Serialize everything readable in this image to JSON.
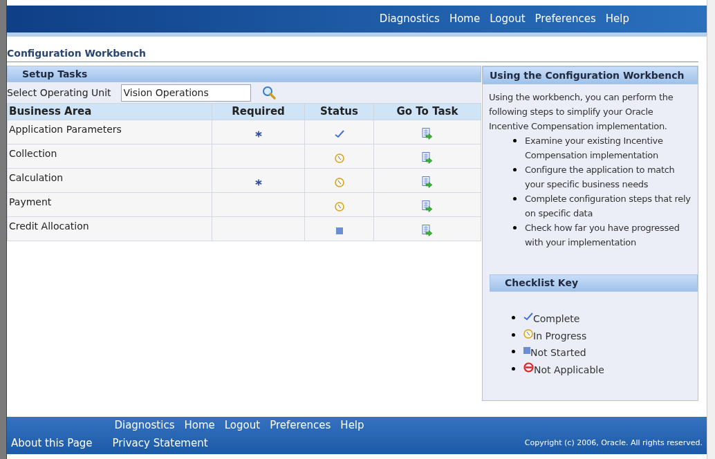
{
  "header_links": [
    "Diagnostics",
    "Home",
    "Logout",
    "Preferences",
    "Help"
  ],
  "page_title": "Configuration Workbench",
  "setup_tasks": {
    "title": "Setup Tasks",
    "operating_unit_label": "Select Operating Unit",
    "operating_unit_value": "Vision Operations",
    "columns": [
      "Business Area",
      "Required",
      "Status",
      "Go To Task"
    ],
    "rows": [
      {
        "business_area": "Application Parameters",
        "required": true,
        "status": {
          "kind": "complete"
        }
      },
      {
        "business_area": "Collection",
        "required": false,
        "status": {
          "kind": "in_progress"
        }
      },
      {
        "business_area": "Calculation",
        "required": true,
        "status": {
          "kind": "in_progress"
        }
      },
      {
        "business_area": "Payment",
        "required": false,
        "status": {
          "kind": "in_progress"
        }
      },
      {
        "business_area": "Credit Allocation",
        "required": false,
        "status": {
          "kind": "not_started"
        }
      }
    ]
  },
  "help_panel": {
    "title": "Using the Configuration Workbench",
    "intro": "Using the workbench, you can perform the following steps to simplify your Oracle Incentive Compensation implementation.",
    "steps": [
      "Examine your existing Incentive Compensation implementation",
      "Configure the application to match your specific business needs",
      "Complete configuration steps that rely on specific data",
      "Check how far you have progressed with your implementation"
    ],
    "key_title": "Checklist Key",
    "key_items": [
      {
        "kind": "complete",
        "label": "Complete"
      },
      {
        "kind": "in_progress",
        "label": "In Progress"
      },
      {
        "kind": "not_started",
        "label": "Not Started"
      },
      {
        "kind": "not_applicable",
        "label": "Not Applicable"
      }
    ]
  },
  "footer_links": [
    "Diagnostics",
    "Home",
    "Logout",
    "Preferences",
    "Help"
  ],
  "footer_bottom_links": [
    "About this Page",
    "Privacy Statement"
  ],
  "copyright": "Copyright (c) 2006, Oracle. All rights reserved."
}
